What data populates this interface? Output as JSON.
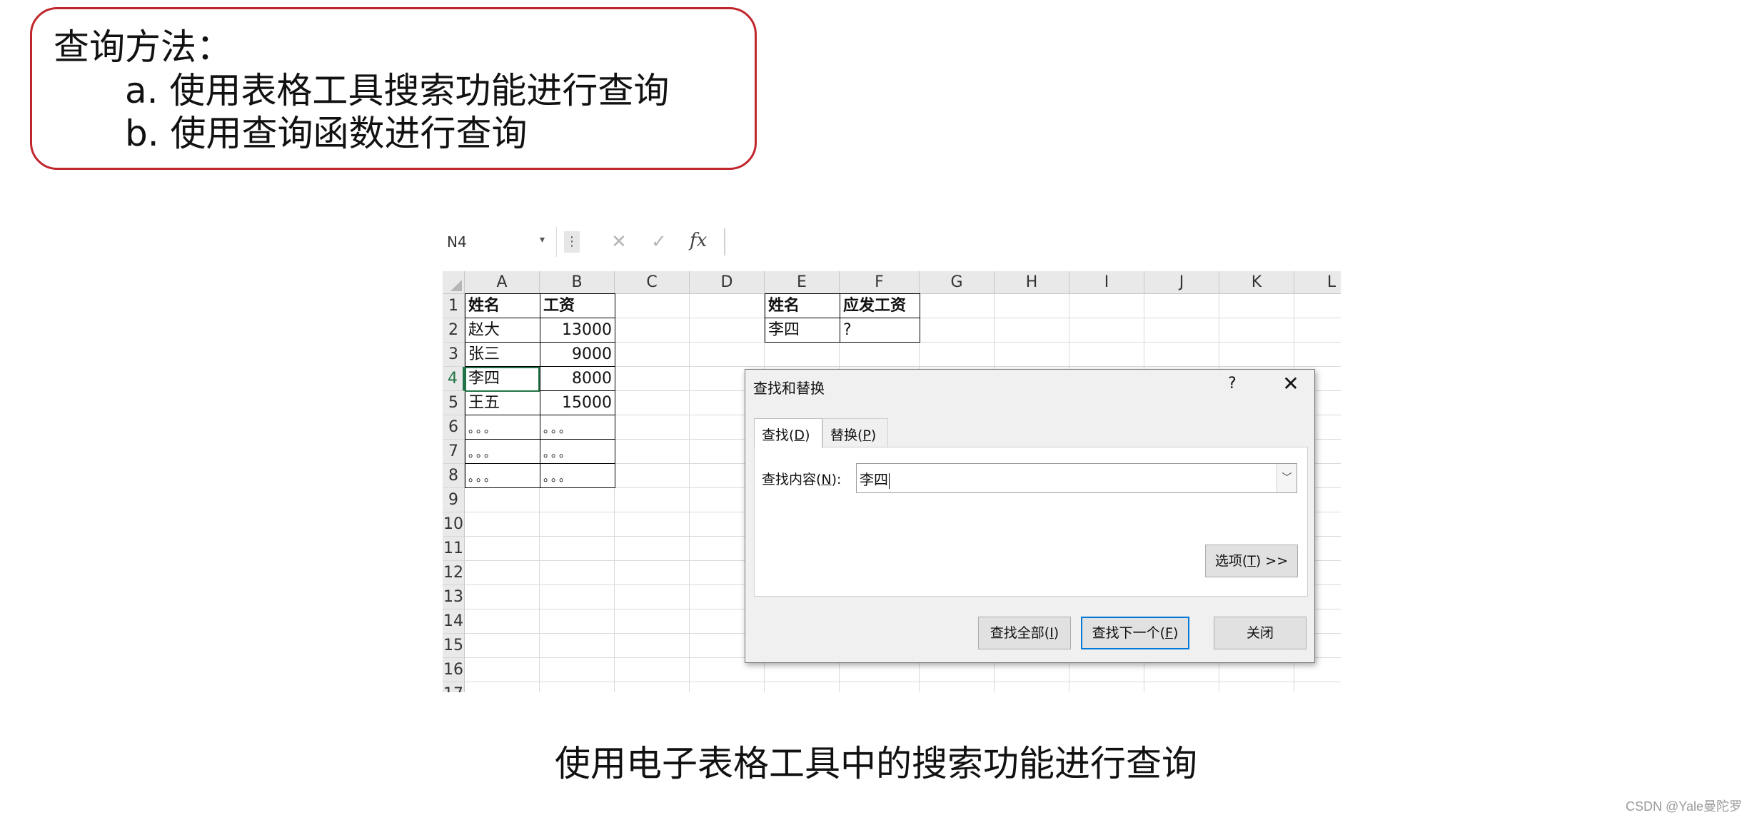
{
  "callout": {
    "title": "查询方法：",
    "items": [
      "a. 使用表格工具搜索功能进行查询",
      "b. 使用查询函数进行查询"
    ]
  },
  "caption": "使用电子表格工具中的搜索功能进行查询",
  "watermark": "CSDN @Yale曼陀罗",
  "spreadsheet": {
    "name_box": "N4",
    "formula_bar": {
      "cancel_icon": "✕",
      "enter_icon": "✓",
      "fx_label": "fx",
      "value": ""
    },
    "columns": [
      "A",
      "B",
      "C",
      "D",
      "E",
      "F",
      "G",
      "H",
      "I",
      "J",
      "K",
      "L"
    ],
    "rows": [
      "1",
      "2",
      "3",
      "4",
      "5",
      "6",
      "7",
      "8",
      "9",
      "10",
      "11",
      "12",
      "13",
      "14",
      "15",
      "16",
      "17"
    ],
    "table1": {
      "headers": [
        "姓名",
        "工资"
      ],
      "rows": [
        [
          "赵大",
          "13000"
        ],
        [
          "张三",
          "9000"
        ],
        [
          "李四",
          "8000"
        ],
        [
          "王五",
          "15000"
        ],
        [
          "。。。",
          "。。。"
        ],
        [
          "。。。",
          "。。。"
        ],
        [
          "。。。",
          "。。。"
        ]
      ]
    },
    "table2": {
      "headers": [
        "姓名",
        "应发工资"
      ],
      "row": [
        "李四",
        "?"
      ]
    },
    "selected_cell": "A4",
    "accent_color": "#217346"
  },
  "dialog": {
    "title": "查找和替换",
    "help": "?",
    "close": "✕",
    "tabs": [
      {
        "text": "查找(",
        "key": "D",
        "end": ")"
      },
      {
        "text": "替换(",
        "key": "P",
        "end": ")"
      }
    ],
    "find_label": {
      "text": "查找内容(",
      "key": "N",
      "end": "):"
    },
    "find_value": "李四",
    "options_button": {
      "text": "选项(",
      "key": "T",
      "end": ") >>"
    },
    "buttons": {
      "find_all": {
        "text": "查找全部(",
        "key": "I",
        "end": ")"
      },
      "find_next": {
        "text": "查找下一个(",
        "key": "F",
        "end": ")"
      },
      "close": "关闭"
    },
    "default_button_color": "#0078d7"
  }
}
